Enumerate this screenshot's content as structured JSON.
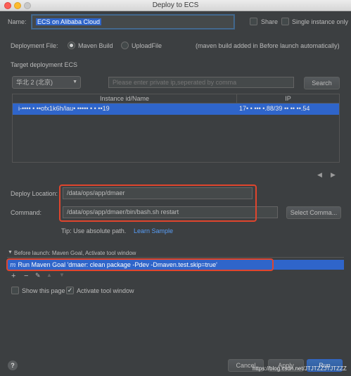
{
  "window": {
    "title": "Deploy to ECS"
  },
  "name": {
    "label": "Name:",
    "value": "ECS on Alibaba Cloud"
  },
  "share": {
    "label": "Share"
  },
  "single_instance": {
    "label": "Single instance only"
  },
  "deployment_file": {
    "label": "Deployment File:",
    "maven_build": "Maven Build",
    "upload_file": "UploadFile",
    "note": "(maven build added in Before launch automatically)"
  },
  "target": {
    "label": "Target deployment ECS"
  },
  "region": {
    "value": "华北 2 (北京)"
  },
  "search": {
    "placeholder": "Please enter private ip,seperated by comma",
    "button": "Search"
  },
  "table": {
    "headers": [
      "Instance id/Name",
      "IP"
    ],
    "rows": [
      {
        "instance": "i-•••• • ••ofx1k6h/lau• ••••• • • ••19",
        "ip": "17• • ••• •.88/39  •• •• ••.54"
      }
    ]
  },
  "deploy_location": {
    "label": "Deploy Location:",
    "value": "/data/ops/app/dmaer"
  },
  "command": {
    "label": "Command:",
    "value": "/data/ops/app/dmaer/bin/bash.sh restart",
    "select_button": "Select Comma..."
  },
  "tip": {
    "text": "Tip: Use absolute path.",
    "link": "Learn Sample"
  },
  "before_launch": {
    "header": "Before launch: Maven Goal, Activate tool window",
    "item": "Run Maven Goal 'dmaer: clean package -Pdev -Dmaven.test.skip=true'"
  },
  "show_page": {
    "label": "Show this page"
  },
  "activate_tool": {
    "label": "Activate tool window"
  },
  "footer": {
    "cancel": "Cancel",
    "apply": "Apply",
    "run": "Run",
    "help": "?"
  },
  "watermark": "https://blog.csdn.net/JTJTZZJTJTZZZ",
  "colors": {
    "accent": "#2f65ca",
    "highlight": "#e0452d",
    "background": "#3c3f41"
  }
}
